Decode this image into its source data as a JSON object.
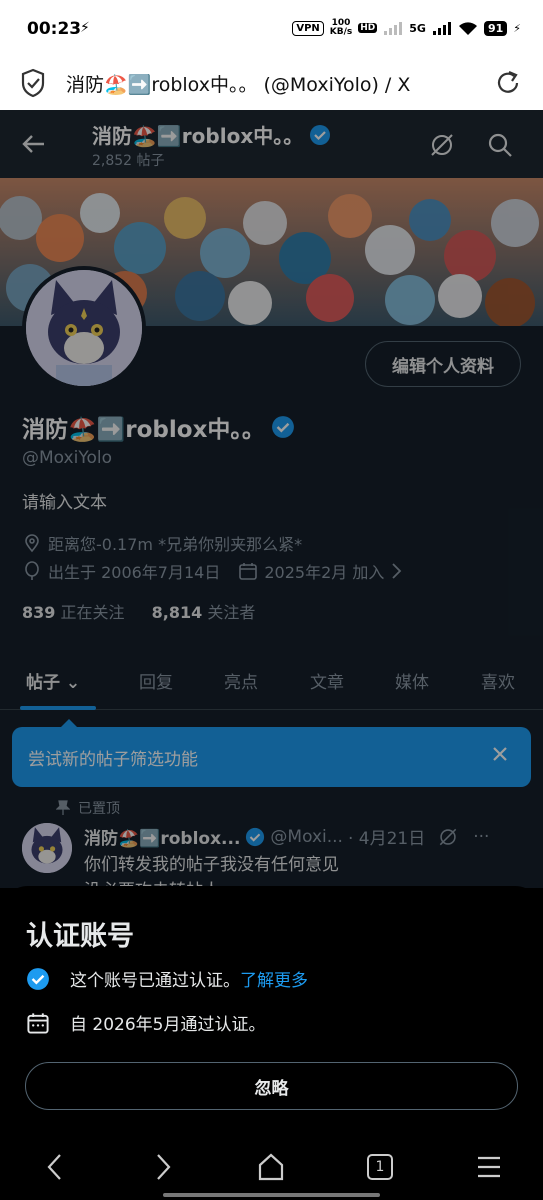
{
  "status_bar": {
    "time": "00:23",
    "vpn": "VPN",
    "speed_value": "100",
    "speed_unit": "KB/s",
    "hd": "HD",
    "network": "5G",
    "battery": "91"
  },
  "browser": {
    "tab_title": "消防🏖️➡️roblox中。。 (@MoxiYolo) / X"
  },
  "profile_header": {
    "name": "消防🏖️➡️roblox中。。",
    "post_count": "2,852 帖子"
  },
  "profile": {
    "edit_button": "编辑个人资料",
    "name": "消防🏖️➡️roblox中。。",
    "handle": "@MoxiYolo",
    "bio": "请输入文本",
    "location": "距离您-0.17m *兄弟你别夹那么紧*",
    "birthday": "出生于 2006年7月14日",
    "joined": "2025年2月 加入",
    "following_count": "839",
    "following_label": "正在关注",
    "followers_count": "8,814",
    "followers_label": "关注者"
  },
  "tabs": [
    "帖子",
    "回复",
    "亮点",
    "文章",
    "媒体",
    "喜欢"
  ],
  "tooltip": {
    "text": "尝试新的帖子筛选功能"
  },
  "pinned_post": {
    "pinned_label": "已置顶",
    "author": "消防🏖️➡️roblox...",
    "handle": "@Moxi...",
    "date": "· 4月21日",
    "line1": "你们转发我的帖子我没有任何意见",
    "line2": "没必要攻击转帖人"
  },
  "sheet": {
    "title": "认证账号",
    "verified_text": "这个账号已通过认证。",
    "learn_more": "了解更多",
    "verified_since": "自 2026年5月通过认证。",
    "dismiss": "忽略"
  },
  "nav_bar": {
    "tab_count": "1"
  },
  "colors": {
    "x_background": "#15202b",
    "accent_blue": "#1d9bf0",
    "muted_text": "#8b98a5",
    "border": "#536471"
  }
}
